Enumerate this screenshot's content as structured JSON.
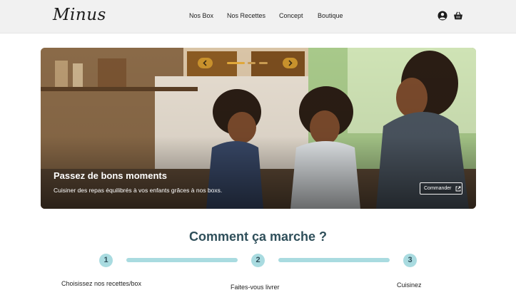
{
  "header": {
    "logo": "Minus",
    "nav": [
      "Nos Box",
      "Nos Recettes",
      "Concept",
      "Boutique"
    ],
    "icons": [
      "user-circle-icon",
      "basket-icon"
    ]
  },
  "hero": {
    "title": "Passez de bons moments",
    "subtitle": "Cuisiner des repas équilibrés à vos enfants grâces à nos boxs.",
    "button": "Commander",
    "carousel": {
      "slides": 3,
      "active": 1
    }
  },
  "how": {
    "title": "Comment ça marche ?",
    "steps": [
      {
        "num": "1",
        "label": "Choisissez nos recettes/box"
      },
      {
        "num": "2",
        "label": "Faites-vous livrer"
      },
      {
        "num": "3",
        "label": "Cuisinez"
      }
    ]
  },
  "colors": {
    "accent": "#a9dbe0",
    "heading": "#2f4f5a",
    "arrow": "#c8912c",
    "topbar": "#f1f1f1"
  }
}
